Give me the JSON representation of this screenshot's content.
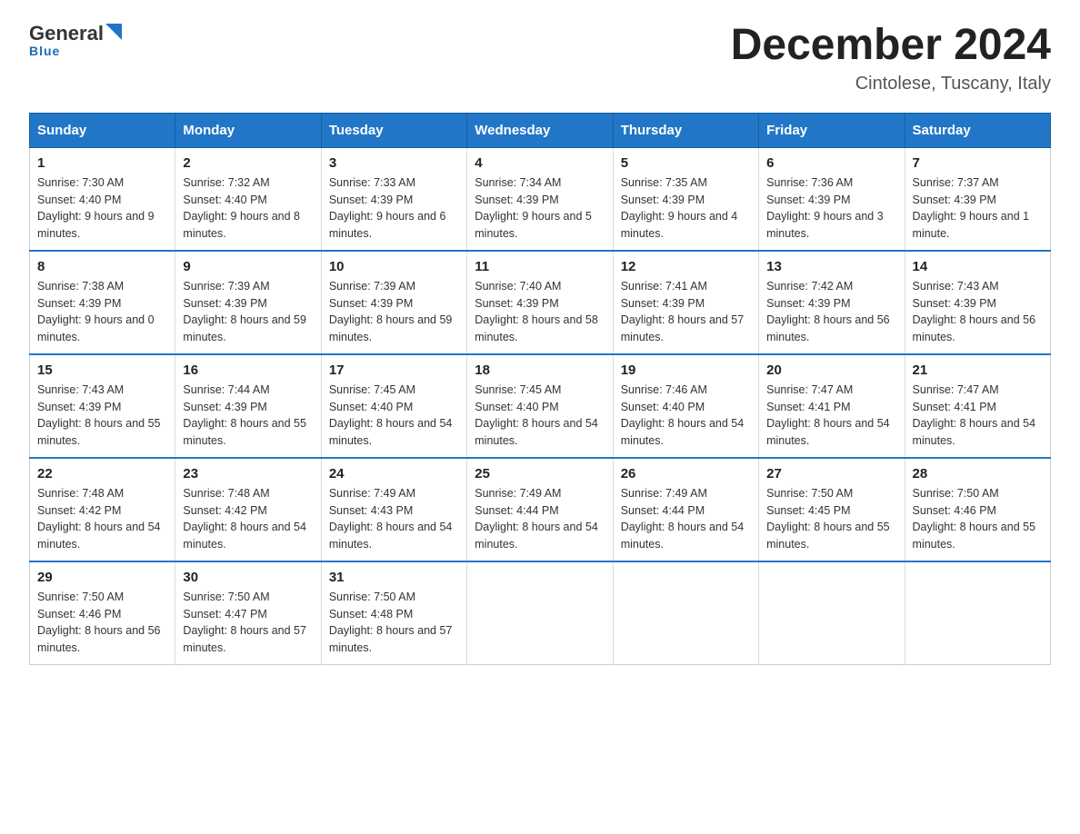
{
  "logo": {
    "general": "General",
    "blue": "Blue",
    "tagline": "Blue"
  },
  "title": "December 2024",
  "subtitle": "Cintolese, Tuscany, Italy",
  "days_of_week": [
    "Sunday",
    "Monday",
    "Tuesday",
    "Wednesday",
    "Thursday",
    "Friday",
    "Saturday"
  ],
  "weeks": [
    [
      {
        "day": "1",
        "sunrise": "7:30 AM",
        "sunset": "4:40 PM",
        "daylight": "9 hours and 9 minutes."
      },
      {
        "day": "2",
        "sunrise": "7:32 AM",
        "sunset": "4:40 PM",
        "daylight": "9 hours and 8 minutes."
      },
      {
        "day": "3",
        "sunrise": "7:33 AM",
        "sunset": "4:39 PM",
        "daylight": "9 hours and 6 minutes."
      },
      {
        "day": "4",
        "sunrise": "7:34 AM",
        "sunset": "4:39 PM",
        "daylight": "9 hours and 5 minutes."
      },
      {
        "day": "5",
        "sunrise": "7:35 AM",
        "sunset": "4:39 PM",
        "daylight": "9 hours and 4 minutes."
      },
      {
        "day": "6",
        "sunrise": "7:36 AM",
        "sunset": "4:39 PM",
        "daylight": "9 hours and 3 minutes."
      },
      {
        "day": "7",
        "sunrise": "7:37 AM",
        "sunset": "4:39 PM",
        "daylight": "9 hours and 1 minute."
      }
    ],
    [
      {
        "day": "8",
        "sunrise": "7:38 AM",
        "sunset": "4:39 PM",
        "daylight": "9 hours and 0 minutes."
      },
      {
        "day": "9",
        "sunrise": "7:39 AM",
        "sunset": "4:39 PM",
        "daylight": "8 hours and 59 minutes."
      },
      {
        "day": "10",
        "sunrise": "7:39 AM",
        "sunset": "4:39 PM",
        "daylight": "8 hours and 59 minutes."
      },
      {
        "day": "11",
        "sunrise": "7:40 AM",
        "sunset": "4:39 PM",
        "daylight": "8 hours and 58 minutes."
      },
      {
        "day": "12",
        "sunrise": "7:41 AM",
        "sunset": "4:39 PM",
        "daylight": "8 hours and 57 minutes."
      },
      {
        "day": "13",
        "sunrise": "7:42 AM",
        "sunset": "4:39 PM",
        "daylight": "8 hours and 56 minutes."
      },
      {
        "day": "14",
        "sunrise": "7:43 AM",
        "sunset": "4:39 PM",
        "daylight": "8 hours and 56 minutes."
      }
    ],
    [
      {
        "day": "15",
        "sunrise": "7:43 AM",
        "sunset": "4:39 PM",
        "daylight": "8 hours and 55 minutes."
      },
      {
        "day": "16",
        "sunrise": "7:44 AM",
        "sunset": "4:39 PM",
        "daylight": "8 hours and 55 minutes."
      },
      {
        "day": "17",
        "sunrise": "7:45 AM",
        "sunset": "4:40 PM",
        "daylight": "8 hours and 54 minutes."
      },
      {
        "day": "18",
        "sunrise": "7:45 AM",
        "sunset": "4:40 PM",
        "daylight": "8 hours and 54 minutes."
      },
      {
        "day": "19",
        "sunrise": "7:46 AM",
        "sunset": "4:40 PM",
        "daylight": "8 hours and 54 minutes."
      },
      {
        "day": "20",
        "sunrise": "7:47 AM",
        "sunset": "4:41 PM",
        "daylight": "8 hours and 54 minutes."
      },
      {
        "day": "21",
        "sunrise": "7:47 AM",
        "sunset": "4:41 PM",
        "daylight": "8 hours and 54 minutes."
      }
    ],
    [
      {
        "day": "22",
        "sunrise": "7:48 AM",
        "sunset": "4:42 PM",
        "daylight": "8 hours and 54 minutes."
      },
      {
        "day": "23",
        "sunrise": "7:48 AM",
        "sunset": "4:42 PM",
        "daylight": "8 hours and 54 minutes."
      },
      {
        "day": "24",
        "sunrise": "7:49 AM",
        "sunset": "4:43 PM",
        "daylight": "8 hours and 54 minutes."
      },
      {
        "day": "25",
        "sunrise": "7:49 AM",
        "sunset": "4:44 PM",
        "daylight": "8 hours and 54 minutes."
      },
      {
        "day": "26",
        "sunrise": "7:49 AM",
        "sunset": "4:44 PM",
        "daylight": "8 hours and 54 minutes."
      },
      {
        "day": "27",
        "sunrise": "7:50 AM",
        "sunset": "4:45 PM",
        "daylight": "8 hours and 55 minutes."
      },
      {
        "day": "28",
        "sunrise": "7:50 AM",
        "sunset": "4:46 PM",
        "daylight": "8 hours and 55 minutes."
      }
    ],
    [
      {
        "day": "29",
        "sunrise": "7:50 AM",
        "sunset": "4:46 PM",
        "daylight": "8 hours and 56 minutes."
      },
      {
        "day": "30",
        "sunrise": "7:50 AM",
        "sunset": "4:47 PM",
        "daylight": "8 hours and 57 minutes."
      },
      {
        "day": "31",
        "sunrise": "7:50 AM",
        "sunset": "4:48 PM",
        "daylight": "8 hours and 57 minutes."
      },
      null,
      null,
      null,
      null
    ]
  ],
  "labels": {
    "sunrise": "Sunrise:",
    "sunset": "Sunset:",
    "daylight": "Daylight:"
  }
}
